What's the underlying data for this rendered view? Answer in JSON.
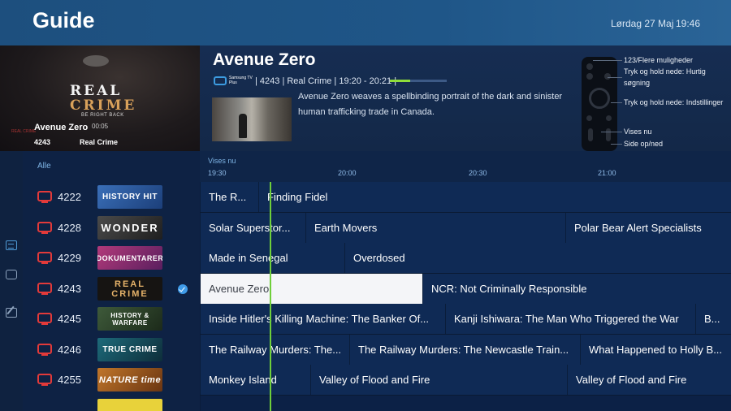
{
  "header": {
    "title": "Guide",
    "date": "Lørdag 27 Maj",
    "time": "19:46"
  },
  "preview": {
    "program_title": "Avenue Zero",
    "duration": "00:05",
    "channel_number": "4243",
    "genre": "Real Crime",
    "logo_line1": "REAL",
    "logo_line2": "CRIME",
    "logo_line3": "BE RIGHT BACK",
    "mini_logo": "REAL CRIME"
  },
  "info": {
    "title": "Avenue Zero",
    "service_name": "Samsung TV Plus",
    "meta": "| 4243 | Real Crime | 19:20 - 20:21 |",
    "progress": 0.36,
    "description": "Avenue Zero weaves a spellbinding portrait of the dark and sinister human trafficking trade in Canada."
  },
  "hints": [
    "123/Flere muligheder",
    "Tryk og hold nede: Hurtig søgning",
    "Tryk og hold nede: Indstillinger",
    "Vises nu",
    "Side op/ned"
  ],
  "timeline": {
    "filter_label": "Alle",
    "now_label": "Vises nu",
    "slots": [
      "19:30",
      "20:00",
      "20:30",
      "21:00"
    ]
  },
  "channels": [
    {
      "number": "4222",
      "logo": "HISTORY HIT",
      "programs": [
        "The R...",
        "Finding Fidel"
      ]
    },
    {
      "number": "4228",
      "logo": "WONDER",
      "programs": [
        "Solar Superstor...",
        "Earth Movers",
        "Polar Bear Alert Specialists"
      ]
    },
    {
      "number": "4229",
      "logo": "DOKUMENTARER",
      "programs": [
        "Made in Senegal",
        "Overdosed"
      ]
    },
    {
      "number": "4243",
      "logo": "REAL CRIME",
      "programs": [
        "Avenue Zero",
        "NCR: Not Criminally Responsible"
      ]
    },
    {
      "number": "4245",
      "logo": "HISTORY & WARFARE",
      "programs": [
        "Inside Hitler's Killing Machine: The Banker Of...",
        "Kanji Ishiwara: The Man Who Triggered the War",
        "B..."
      ]
    },
    {
      "number": "4246",
      "logo": "TRUE CRIME",
      "programs": [
        "The Railway Murders: The...",
        "The Railway Murders: The Newcastle Train...",
        "What Happened to Holly B..."
      ]
    },
    {
      "number": "4255",
      "logo": "NATURE time",
      "programs": [
        "Monkey Island",
        "Valley of Flood and Fire",
        "Valley of Flood and Fire"
      ]
    }
  ],
  "colors": {
    "accent": "#3f9be8",
    "now_line": "#6fcf3a",
    "channel_icon": "#e33a3a",
    "selected_bg": "#f4f5f8"
  }
}
